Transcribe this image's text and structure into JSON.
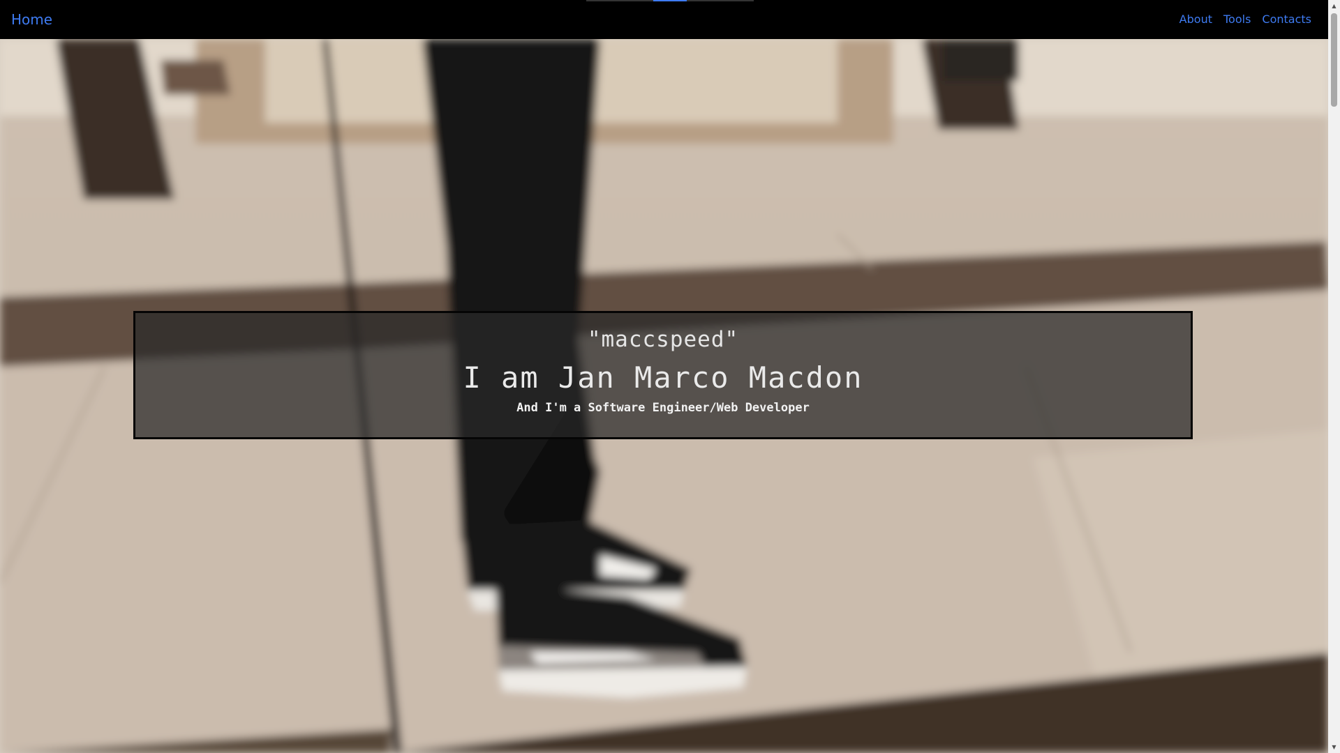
{
  "navbar": {
    "brand": "Home",
    "links": [
      "About",
      "Tools",
      "Contacts"
    ],
    "link_color": "#3e7bf2",
    "background": "#000000"
  },
  "hero": {
    "nickname": "\"maccspeed\"",
    "name": "I am Jan Marco Macdon",
    "role": "And I'm a Software Engineer/Web Developer"
  },
  "background_image": {
    "subject": "blurred photo of legs in black jeans and black-and-white sneakers on a marble floor"
  },
  "scrollbar": {
    "up_arrow": "▲",
    "down_arrow": "▼"
  }
}
